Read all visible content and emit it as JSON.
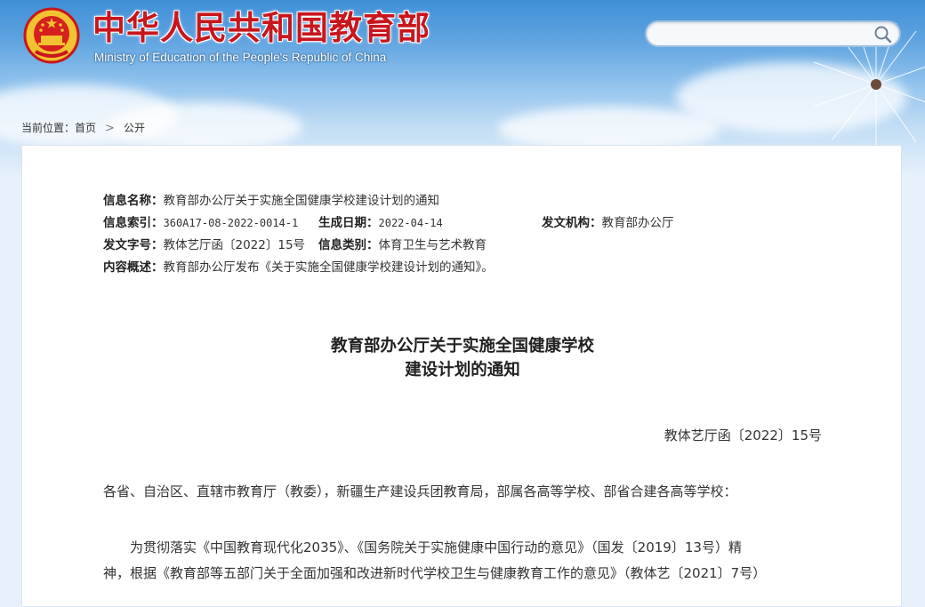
{
  "header": {
    "site_title": "中华人民共和国教育部",
    "site_subtitle": "Ministry of Education of the People's Republic of China",
    "search": {
      "value": "",
      "placeholder": ""
    }
  },
  "breadcrumb": {
    "prefix": "当前位置：",
    "home": "首页",
    "separator": ">",
    "current": "公开"
  },
  "meta": {
    "name_label": "信息名称：",
    "name_value": "教育部办公厅关于实施全国健康学校建设计划的通知",
    "index_label": "信息索引：",
    "index_value": "360A17-08-2022-0014-1",
    "date_label": "生成日期：",
    "date_value": "2022-04-14",
    "org_label": "发文机构：",
    "org_value": "教育部办公厅",
    "docno_label": "发文字号：",
    "docno_value": "教体艺厅函〔2022〕15号",
    "category_label": "信息类别：",
    "category_value": "体育卫生与艺术教育",
    "summary_label": "内容概述：",
    "summary_value": "教育部办公厅发布《关于实施全国健康学校建设计划的通知》。"
  },
  "document": {
    "title_line1": "教育部办公厅关于实施全国健康学校",
    "title_line2": "建设计划的通知",
    "number": "教体艺厅函〔2022〕15号",
    "salutation": "各省、自治区、直辖市教育厅（教委），新疆生产建设兵团教育局，部属各高等学校、部省合建各高等学校：",
    "paragraph_line1": "为贯彻落实《中国教育现代化2035》、《国务院关于实施健康中国行动的意见》（国发〔2019〕13号）精",
    "paragraph_line2": "神，根据《教育部等五部门关于全面加强和改进新时代学校卫生与健康教育工作的意见》（教体艺〔2021〕7号）"
  },
  "colors": {
    "title_red": "#c8161d",
    "header_blue": "#3f8fd7",
    "page_bg": "#e6f1fb"
  },
  "icons": {
    "emblem": "national-emblem-icon",
    "search": "search-icon",
    "breadcrumb_separator": "chevron-right-icon"
  }
}
